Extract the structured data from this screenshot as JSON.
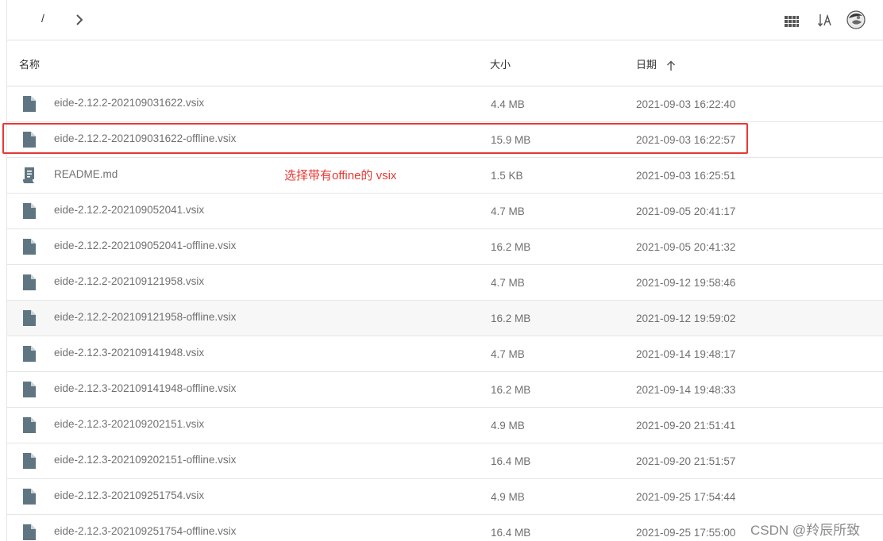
{
  "breadcrumb": {
    "separator": "/"
  },
  "columns": {
    "name": "名称",
    "size": "大小",
    "date": "日期"
  },
  "files": [
    {
      "name": "eide-2.12.2-202109031622.vsix",
      "size": "4.4 MB",
      "date": "2021-09-03 16:22:40",
      "icon": "file-icon"
    },
    {
      "name": "eide-2.12.2-202109031622-offline.vsix",
      "size": "15.9 MB",
      "date": "2021-09-03 16:22:57",
      "icon": "file-icon"
    },
    {
      "name": "README.md",
      "size": "1.5 KB",
      "date": "2021-09-03 16:25:51",
      "icon": "readme-icon"
    },
    {
      "name": "eide-2.12.2-202109052041.vsix",
      "size": "4.7 MB",
      "date": "2021-09-05 20:41:17",
      "icon": "file-icon"
    },
    {
      "name": "eide-2.12.2-202109052041-offline.vsix",
      "size": "16.2 MB",
      "date": "2021-09-05 20:41:32",
      "icon": "file-icon"
    },
    {
      "name": "eide-2.12.2-202109121958.vsix",
      "size": "4.7 MB",
      "date": "2021-09-12 19:58:46",
      "icon": "file-icon"
    },
    {
      "name": "eide-2.12.2-202109121958-offline.vsix",
      "size": "16.2 MB",
      "date": "2021-09-12 19:59:02",
      "icon": "file-icon"
    },
    {
      "name": "eide-2.12.3-202109141948.vsix",
      "size": "4.7 MB",
      "date": "2021-09-14 19:48:17",
      "icon": "file-icon"
    },
    {
      "name": "eide-2.12.3-202109141948-offline.vsix",
      "size": "16.2 MB",
      "date": "2021-09-14 19:48:33",
      "icon": "file-icon"
    },
    {
      "name": "eide-2.12.3-202109202151.vsix",
      "size": "4.9 MB",
      "date": "2021-09-20 21:51:41",
      "icon": "file-icon"
    },
    {
      "name": "eide-2.12.3-202109202151-offline.vsix",
      "size": "16.4 MB",
      "date": "2021-09-20 21:51:57",
      "icon": "file-icon"
    },
    {
      "name": "eide-2.12.3-202109251754.vsix",
      "size": "4.9 MB",
      "date": "2021-09-25 17:54:44",
      "icon": "file-icon"
    },
    {
      "name": "eide-2.12.3-202109251754-offline.vsix",
      "size": "16.4 MB",
      "date": "2021-09-25 17:55:00",
      "icon": "file-icon"
    }
  ],
  "annotation": "选择带有offine的 vsix",
  "watermark": "CSDN @羚辰所致",
  "colors": {
    "icon": "#5f7682",
    "annotation": "#e53935",
    "row_hover": "#f7f7f7"
  }
}
